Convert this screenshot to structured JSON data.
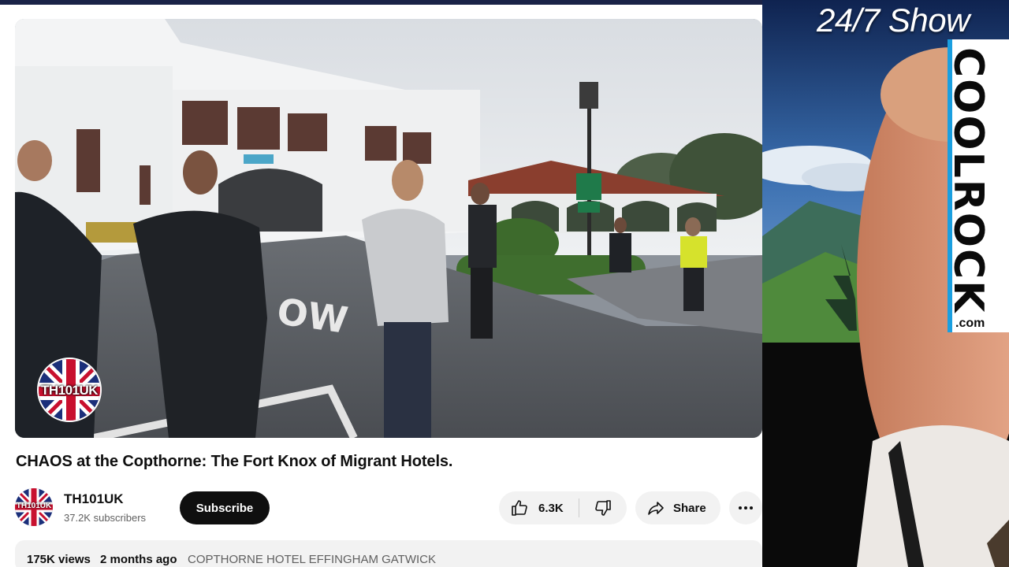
{
  "video": {
    "title": "CHAOS at the Copthorne: The Fort Knox of Migrant Hotels.",
    "watermark": "TH101UK",
    "scene_text": {
      "road_marking": "OW"
    }
  },
  "channel": {
    "avatar_text": "TH101UK",
    "name": "TH101UK",
    "subscribers": "37.2K subscribers",
    "subscribe_label": "Subscribe"
  },
  "actions": {
    "like_count": "6.3K",
    "share_label": "Share",
    "like_icon": "thumbs-up-icon",
    "dislike_icon": "thumbs-down-icon",
    "share_icon": "share-arrow-icon",
    "more_icon": "more-dots-icon"
  },
  "description": {
    "views": "175K views",
    "date": "2 months ago",
    "tag": "COPTHORNE HOTEL EFFINGHAM GATWICK"
  },
  "overlay": {
    "show_title": "24/7 Show",
    "brand": "COOLROCK",
    "brand_suffix": ".com"
  },
  "colors": {
    "subscribe_bg": "#0f0f0f",
    "pill_bg": "#f2f2f2",
    "brand_accent": "#1a9fe0",
    "title_text": "#0f0f0f",
    "secondary_text": "#606060"
  }
}
